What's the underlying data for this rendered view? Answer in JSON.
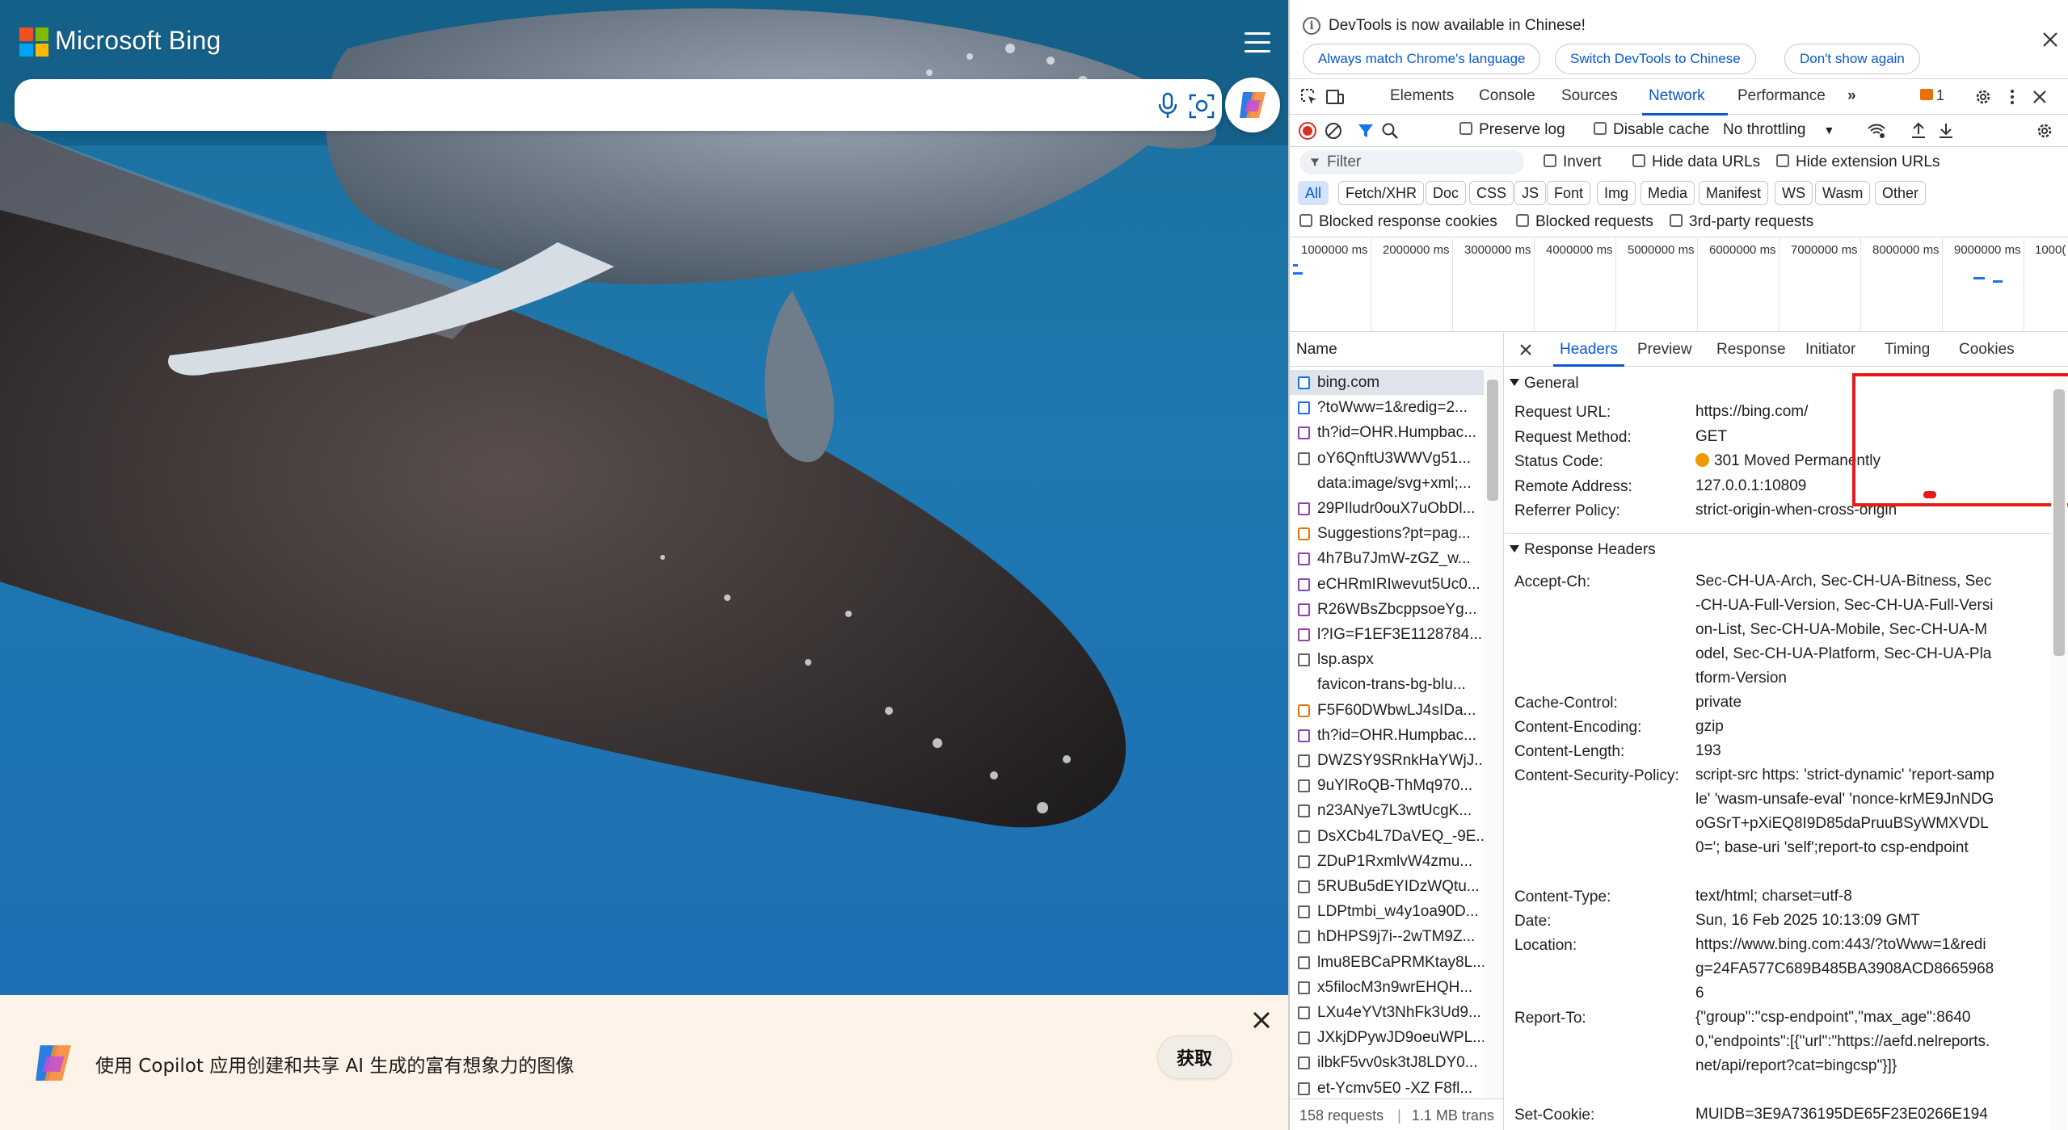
{
  "bing": {
    "brand": "Microsoft Bing",
    "search": {
      "value": "",
      "placeholder": ""
    },
    "promo": {
      "text": "使用 Copilot 应用创建和共享 AI 生成的富有想象力的图像",
      "get_button": "获取"
    }
  },
  "devtools": {
    "infobar": {
      "message": "DevTools is now available in Chinese!",
      "buttons": [
        "Always match Chrome's language",
        "Switch DevTools to Chinese",
        "Don't show again"
      ]
    },
    "tabs": [
      "Elements",
      "Console",
      "Sources",
      "Network",
      "Performance"
    ],
    "active_tab": "Network",
    "issues_count": "1",
    "toolbar": {
      "preserve_log": "Preserve log",
      "disable_cache": "Disable cache",
      "throttling": "No throttling"
    },
    "filter": {
      "placeholder": "Filter",
      "invert": "Invert",
      "hide_data_urls": "Hide data URLs",
      "hide_extension_urls": "Hide extension URLs"
    },
    "type_filters": [
      "All",
      "Fetch/XHR",
      "Doc",
      "CSS",
      "JS",
      "Font",
      "Img",
      "Media",
      "Manifest",
      "WS",
      "Wasm",
      "Other"
    ],
    "blocked": {
      "blocked_response_cookies": "Blocked response cookies",
      "blocked_requests": "Blocked requests",
      "third_party": "3rd-party requests"
    },
    "overview_ticks": [
      "1000000 ms",
      "2000000 ms",
      "3000000 ms",
      "4000000 ms",
      "5000000 ms",
      "6000000 ms",
      "7000000 ms",
      "8000000 ms",
      "9000000 ms",
      "1000("
    ],
    "name_header": "Name",
    "requests": [
      {
        "name": "bing.com",
        "icon": "doc"
      },
      {
        "name": "?toWww=1&redig=2...",
        "icon": "doc"
      },
      {
        "name": "th?id=OHR.Humpbac...",
        "icon": "img"
      },
      {
        "name": "oY6QnftU3WWVg51...",
        "icon": "file"
      },
      {
        "name": "data:image/svg+xml;...",
        "icon": "none"
      },
      {
        "name": "29PIludr0ouX7uObDl...",
        "icon": "img"
      },
      {
        "name": "Suggestions?pt=pag...",
        "icon": "script"
      },
      {
        "name": "4h7Bu7JmW-zGZ_w...",
        "icon": "img"
      },
      {
        "name": "eCHRmIRIwevut5Uc0...",
        "icon": "img"
      },
      {
        "name": "R26WBsZbcppsoeYg...",
        "icon": "img"
      },
      {
        "name": "l?IG=F1EF3E1128784...",
        "icon": "img"
      },
      {
        "name": "lsp.aspx",
        "icon": "file"
      },
      {
        "name": "favicon-trans-bg-blu...",
        "icon": "none"
      },
      {
        "name": "F5F60DWbwLJ4sIDa...",
        "icon": "script"
      },
      {
        "name": "th?id=OHR.Humpbac...",
        "icon": "img"
      },
      {
        "name": "DWZSY9SRnkHaYWjJ...",
        "icon": "file"
      },
      {
        "name": "9uYlRoQB-ThMq970...",
        "icon": "file"
      },
      {
        "name": "n23ANye7L3wtUcgK...",
        "icon": "file"
      },
      {
        "name": "DsXCb4L7DaVEQ_-9E...",
        "icon": "file"
      },
      {
        "name": "ZDuP1RxmlvW4zmu...",
        "icon": "file"
      },
      {
        "name": "5RUBu5dEYIDzWQtu...",
        "icon": "file"
      },
      {
        "name": "LDPtmbi_w4y1oa90D...",
        "icon": "file"
      },
      {
        "name": "hDHPS9j7i--2wTM9Z...",
        "icon": "file"
      },
      {
        "name": "lmu8EBCaPRMKtay8L...",
        "icon": "file"
      },
      {
        "name": "x5filocM3n9wrEHQH...",
        "icon": "file"
      },
      {
        "name": "LXu4eYVt3NhFk3Ud9...",
        "icon": "file"
      },
      {
        "name": "JXkjDPywJD9oeuWPL...",
        "icon": "file"
      },
      {
        "name": "ilbkF5vv0sk3tJ8LDY0...",
        "icon": "file"
      },
      {
        "name": "et-Ycmv5E0 -XZ F8fl...",
        "icon": "file"
      }
    ],
    "footer": {
      "requests": "158 requests",
      "transferred": "1.1 MB trans"
    },
    "detail_tabs": [
      "Headers",
      "Preview",
      "Response",
      "Initiator",
      "Timing",
      "Cookies"
    ],
    "general": {
      "title": "General",
      "rows": [
        {
          "key": "Request URL:",
          "value": "https://bing.com/"
        },
        {
          "key": "Request Method:",
          "value": "GET"
        },
        {
          "key": "Status Code:",
          "value": "301 Moved Permanently"
        },
        {
          "key": "Remote Address:",
          "value": "127.0.0.1:10809"
        },
        {
          "key": "Referrer Policy:",
          "value": "strict-origin-when-cross-origin"
        }
      ]
    },
    "response_headers": {
      "title": "Response Headers",
      "rows": [
        {
          "key": "Accept-Ch:",
          "value": "Sec-CH-UA-Arch, Sec-CH-UA-Bitness, Sec-CH-UA-Full-Version, Sec-CH-UA-Full-Version-List, Sec-CH-UA-Mobile, Sec-CH-UA-Model, Sec-CH-UA-Platform, Sec-CH-UA-Platform-Version"
        },
        {
          "key": "Cache-Control:",
          "value": "private"
        },
        {
          "key": "Content-Encoding:",
          "value": "gzip"
        },
        {
          "key": "Content-Length:",
          "value": "193"
        },
        {
          "key": "Content-Security-Policy:",
          "value": "script-src https: 'strict-dynamic' 'report-sample' 'wasm-unsafe-eval' 'nonce-krME9JnNDGoGSrT+pXiEQ8I9D85daPruuBSyWMXVDL0='; base-uri 'self';report-to csp-endpoint"
        },
        {
          "key": "Content-Type:",
          "value": "text/html; charset=utf-8"
        },
        {
          "key": "Date:",
          "value": "Sun, 16 Feb 2025 10:13:09 GMT"
        },
        {
          "key": "Location:",
          "value": "https://www.bing.com:443/?toWww=1&redig=24FA577C689B485BA3908ACD86659686"
        },
        {
          "key": "Report-To:",
          "value": "{\"group\":\"csp-endpoint\",\"max_age\":86400,\"endpoints\":[{\"url\":\"https://aefd.nelreports.net/api/report?cat=bingcsp\"}]}"
        },
        {
          "key": "Set-Cookie:",
          "value": "MUIDB=3E9A736195DE65F23E0266E194"
        }
      ]
    }
  }
}
